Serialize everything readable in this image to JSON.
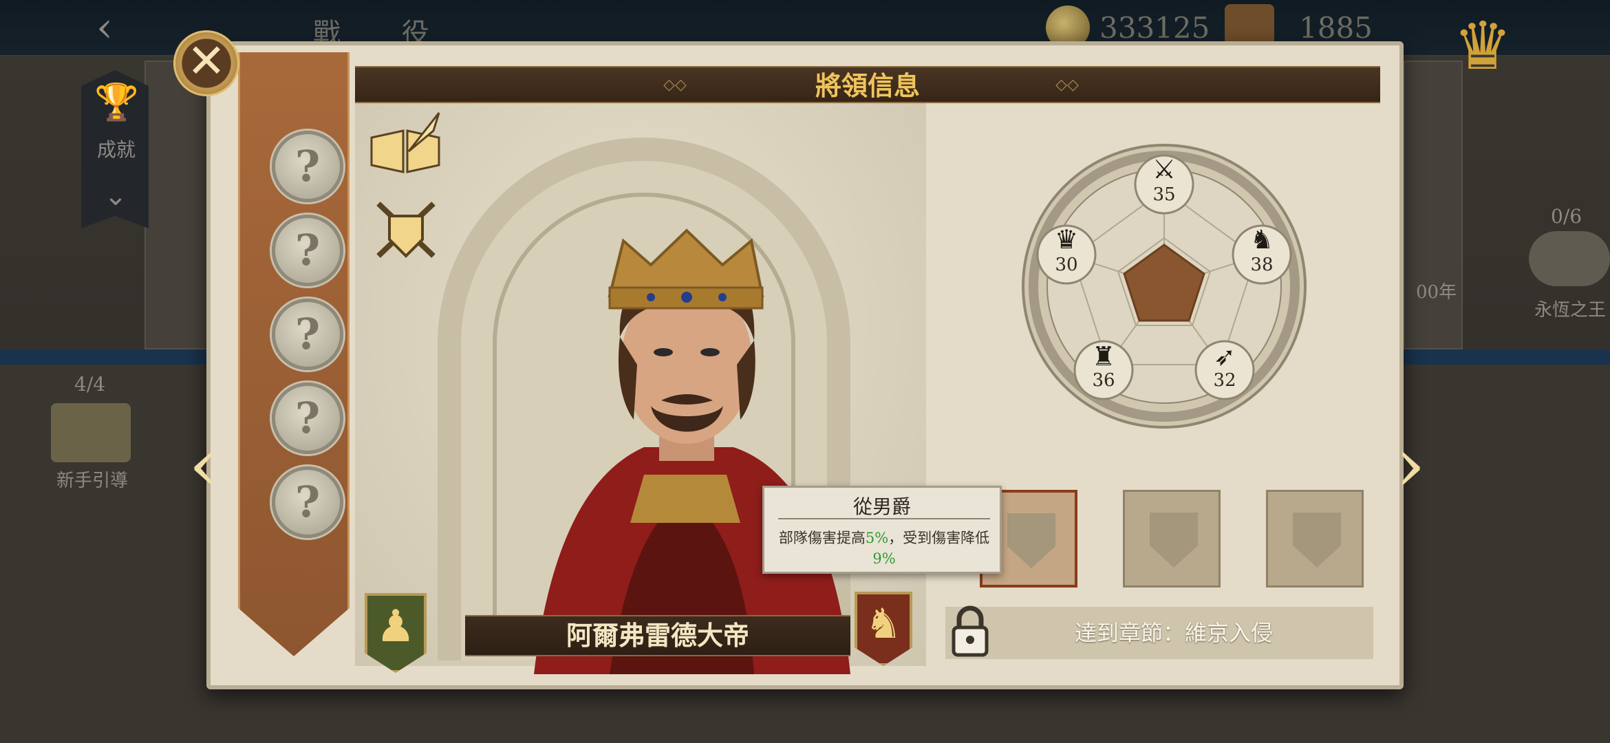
{
  "top_bar": {
    "back_label": "‹",
    "title": "戰 役",
    "coins": "333125",
    "gems": "1885"
  },
  "background": {
    "achievement_label": "成就",
    "guide_count": "4/4",
    "guide_label": "新手引導",
    "right_count": "0/6",
    "right_label": "永恆之王",
    "right_year": "00年"
  },
  "modal": {
    "title": "將領信息",
    "close_label": "✕",
    "general_name": "阿爾弗雷德大帝",
    "skill_slots": [
      "?",
      "?",
      "?",
      "?",
      "?"
    ],
    "stats": [
      {
        "icon": "swords-icon",
        "value": "35"
      },
      {
        "icon": "horse-icon",
        "value": "38"
      },
      {
        "icon": "bow-icon",
        "value": "32"
      },
      {
        "icon": "eagle-icon",
        "value": "36"
      },
      {
        "icon": "crown-icon",
        "value": "30"
      }
    ],
    "tooltip": {
      "title": "從男爵",
      "desc_prefix": "部隊傷害提高",
      "desc_val1": "5%",
      "desc_mid": "，受到傷害降低",
      "desc_val2": "9%"
    },
    "unlock_text": "達到章節：維京入侵",
    "nav_left": "‹",
    "nav_right": "›"
  },
  "colors": {
    "accent_gold": "#f0c45c",
    "header_brown": "#3d2c1d",
    "green_highlight": "#2f9a34"
  }
}
